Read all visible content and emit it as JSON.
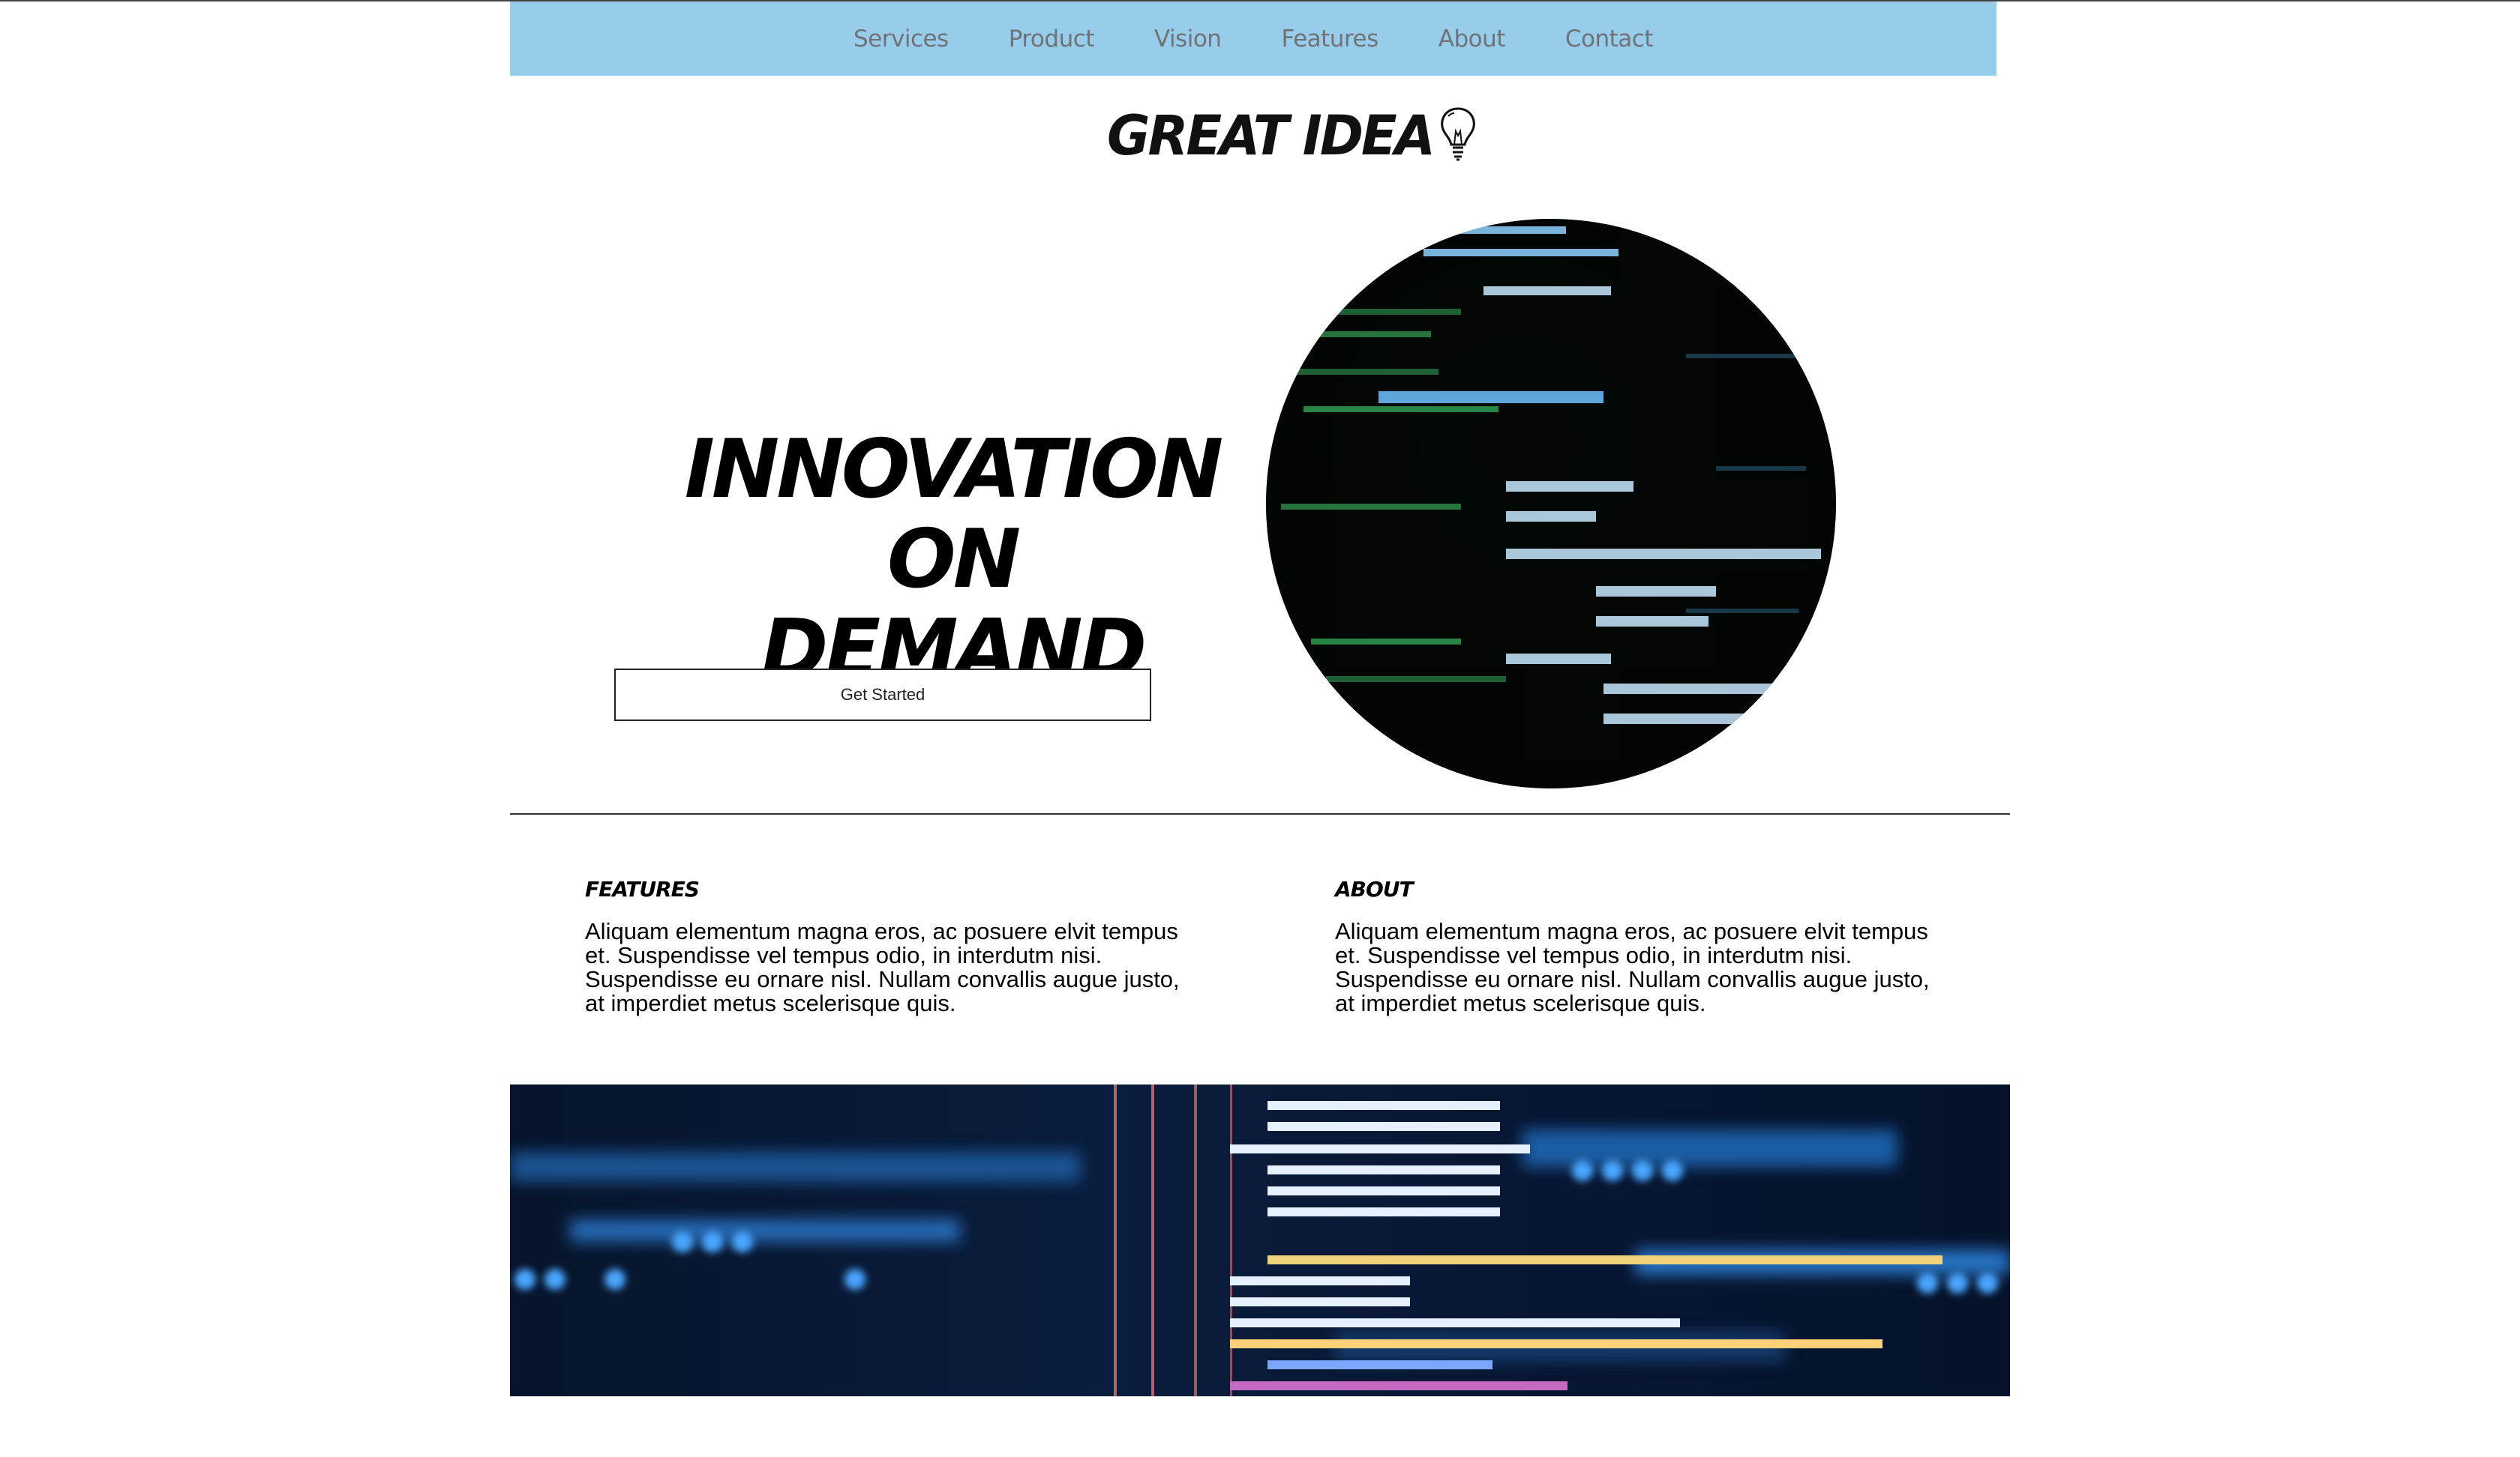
{
  "nav": {
    "items": [
      "Services",
      "Product",
      "Vision",
      "Features",
      "About",
      "Contact"
    ]
  },
  "logo": {
    "text": "GREAT IDEA",
    "icon": "lightbulb-icon"
  },
  "hero": {
    "title_lines": [
      "INNOVATION",
      "ON",
      "DEMAND"
    ],
    "cta_label": "Get Started",
    "image": "code-screen-circle-image"
  },
  "sections": [
    {
      "heading": "FEATURES",
      "body": "Aliquam elementum magna eros, ac posuere elvit tempus et. Suspendisse vel tempus odio, in interdutm nisi. Suspendisse eu ornare nisl. Nullam convallis augue justo, at imperdiet metus scelerisque quis."
    },
    {
      "heading": "ABOUT",
      "body": "Aliquam elementum magna eros, ac posuere elvit tempus et. Suspendisse vel tempus odio, in interdutm nisi. Suspendisse eu ornare nisl. Nullam convallis augue justo, at imperdiet metus scelerisque quis."
    }
  ],
  "banner": {
    "image": "code-banner-image"
  },
  "colors": {
    "nav_bg": "#97cdea",
    "nav_text": "#6f7378",
    "text": "#000000"
  }
}
